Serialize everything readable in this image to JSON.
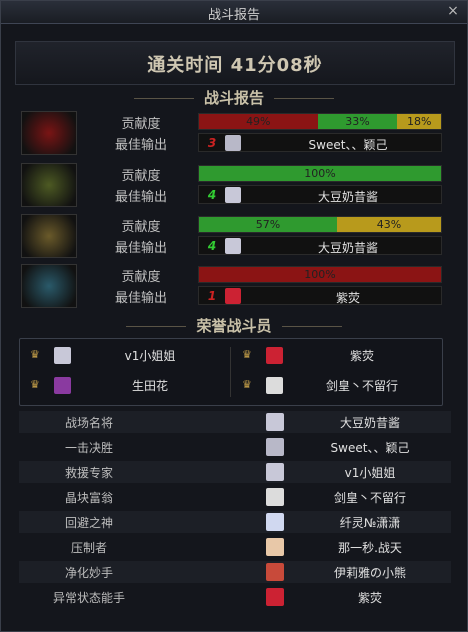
{
  "window": {
    "title": "战斗报告",
    "close_glyph": "×"
  },
  "clear_time": "通关时间   41分08秒",
  "section_report": "战斗报告",
  "section_honor": "荣誉战斗员",
  "labels": {
    "contribution": "贡献度",
    "best_output": "最佳输出"
  },
  "players": [
    {
      "avatar_color": "#7a1414",
      "segments": [
        {
          "label": "49%",
          "value": 49,
          "color": "#8b1414"
        },
        {
          "label": "33%",
          "value": 33,
          "color": "#2f9a2f"
        },
        {
          "label": "18%",
          "value": 18,
          "color": "#b89a1c"
        }
      ],
      "best_output": {
        "badge": "3",
        "badge_color": "#cc2222",
        "mini_color": "#b8b8c8",
        "name": "Sweet、、颖己"
      }
    },
    {
      "avatar_color": "#4d5a23",
      "segments": [
        {
          "label": "100%",
          "value": 100,
          "color": "#2f9a2f"
        }
      ],
      "best_output": {
        "badge": "4",
        "badge_color": "#33cc33",
        "mini_color": "#c8c8d8",
        "name": "大豆奶昔酱"
      }
    },
    {
      "avatar_color": "#6a5a2a",
      "segments": [
        {
          "label": "57%",
          "value": 57,
          "color": "#2f9a2f"
        },
        {
          "label": "43%",
          "value": 43,
          "color": "#b89a1c"
        }
      ],
      "best_output": {
        "badge": "4",
        "badge_color": "#33cc33",
        "mini_color": "#c8c8d8",
        "name": "大豆奶昔酱"
      }
    },
    {
      "avatar_color": "#2a5a6a",
      "segments": [
        {
          "label": "100%",
          "value": 100,
          "color": "#8b1414"
        }
      ],
      "best_output": {
        "badge": "1",
        "badge_color": "#cc2222",
        "mini_color": "#cc2233",
        "name": "紫荧"
      }
    }
  ],
  "honor": [
    {
      "name": "v1小姐姐",
      "avatar_color": "#c8c8d8"
    },
    {
      "name": "紫荧",
      "avatar_color": "#cc2233"
    },
    {
      "name": "生田花",
      "avatar_color": "#8a3aa0"
    },
    {
      "name": "剑皇丶不留行",
      "avatar_color": "#dcdcdc"
    }
  ],
  "awards": [
    {
      "title": "战场名将",
      "player": "大豆奶昔酱",
      "avatar_color": "#c8c8d8"
    },
    {
      "title": "一击决胜",
      "player": "Sweet、、颖己",
      "avatar_color": "#b8b8c8"
    },
    {
      "title": "救援专家",
      "player": "v1小姐姐",
      "avatar_color": "#c8c8d8"
    },
    {
      "title": "晶块富翁",
      "player": "剑皇丶不留行",
      "avatar_color": "#dcdcdc"
    },
    {
      "title": "回避之神",
      "player": "纤灵№潇潇",
      "avatar_color": "#d0d8f0"
    },
    {
      "title": "压制者",
      "player": "那一秒.战天",
      "avatar_color": "#e8c8a8"
    },
    {
      "title": "净化妙手",
      "player": "伊莉雅の小熊",
      "avatar_color": "#c84a3a"
    },
    {
      "title": "异常状态能手",
      "player": "紫荧",
      "avatar_color": "#cc2233"
    }
  ]
}
